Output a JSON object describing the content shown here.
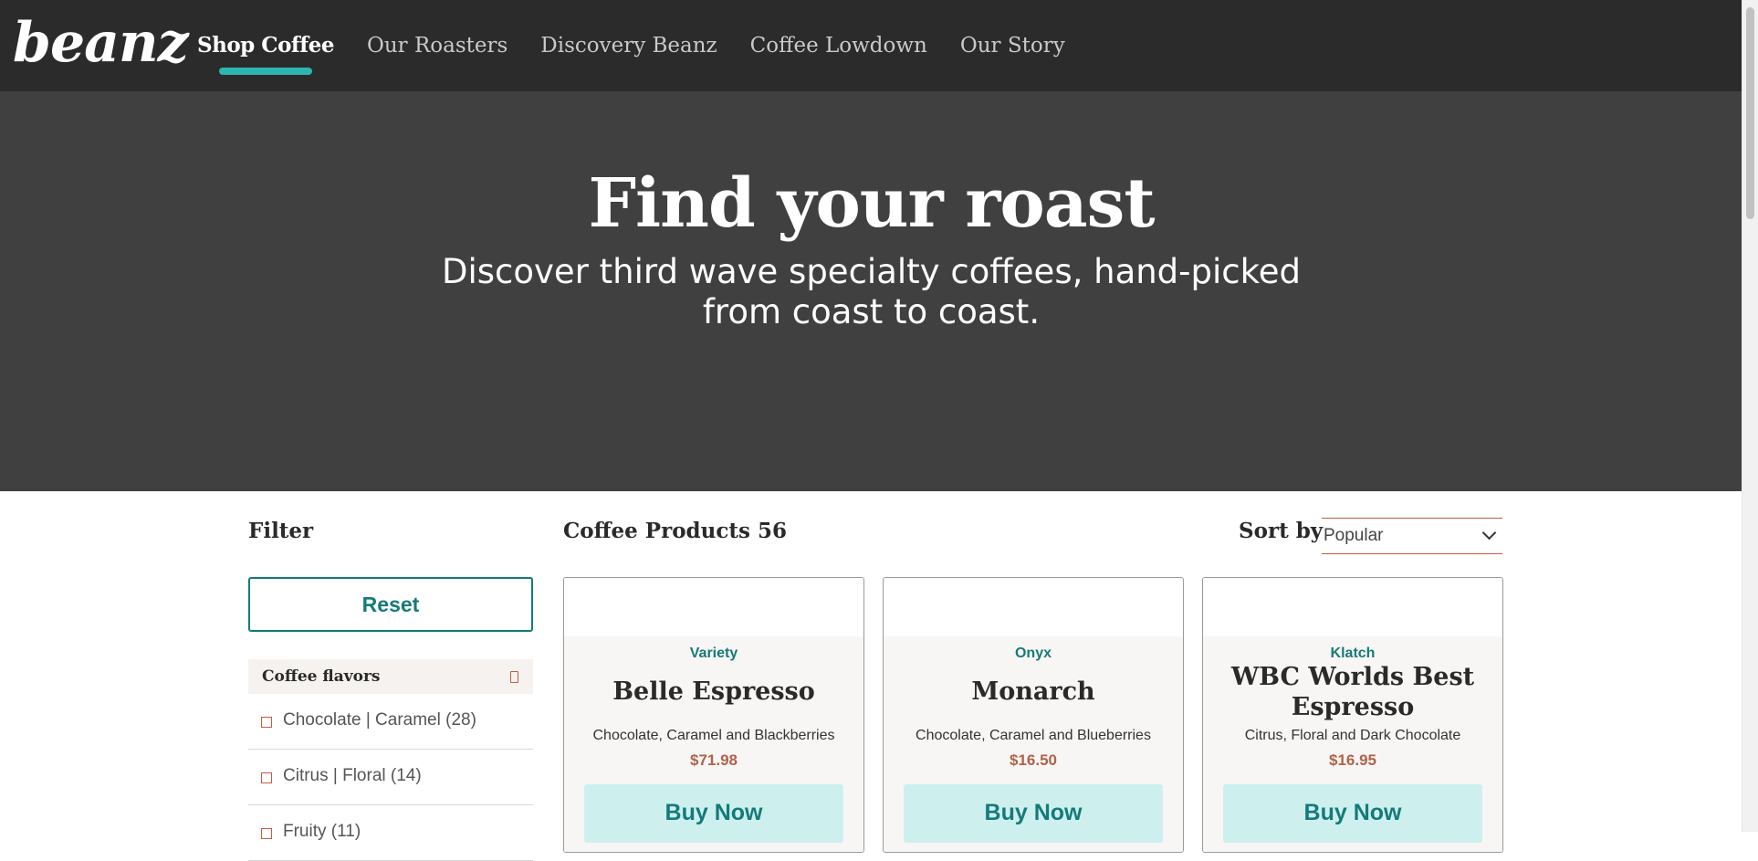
{
  "brand": {
    "logo_text": "beanz"
  },
  "nav": {
    "items": [
      {
        "label": "Shop Coffee",
        "active": true
      },
      {
        "label": "Our Roasters",
        "active": false
      },
      {
        "label": "Discovery Beanz",
        "active": false
      },
      {
        "label": "Coffee Lowdown",
        "active": false
      },
      {
        "label": "Our Story",
        "active": false
      }
    ]
  },
  "hero": {
    "title": "Find your roast",
    "subtitle_line1": "Discover third wave specialty coffees, hand-picked",
    "subtitle_line2": "from coast to coast."
  },
  "filter": {
    "title": "Filter",
    "reset_label": "Reset",
    "flavors_heading": "Coffee flavors",
    "flavors": [
      {
        "label": "Chocolate | Caramel (28)"
      },
      {
        "label": "Citrus | Floral (14)"
      },
      {
        "label": "Fruity (11)"
      }
    ]
  },
  "products": {
    "title": "Coffee Products 56",
    "sort_label": "Sort by",
    "sort_value": "Popular",
    "items": [
      {
        "roaster": "Variety",
        "name_line1": "Belle Espresso",
        "name_line2": "",
        "notes": "Chocolate, Caramel and Blackberries",
        "price": "$71.98",
        "buy_label": "Buy Now"
      },
      {
        "roaster": "Onyx",
        "name_line1": "Monarch",
        "name_line2": "",
        "notes": "Chocolate, Caramel and Blueberries",
        "price": "$16.50",
        "buy_label": "Buy Now"
      },
      {
        "roaster": "Klatch",
        "name_line1": "WBC Worlds Best",
        "name_line2": "Espresso",
        "notes": "Citrus, Floral and Dark Chocolate",
        "price": "$16.95",
        "buy_label": "Buy Now"
      }
    ]
  },
  "colors": {
    "nav_bg": "#2b2b2b",
    "hero_bg": "#404040",
    "accent_teal": "#157a7a",
    "nav_underline": "#2fb5b0",
    "price_color": "#b0624a",
    "buy_bg": "#cdf0ef"
  }
}
